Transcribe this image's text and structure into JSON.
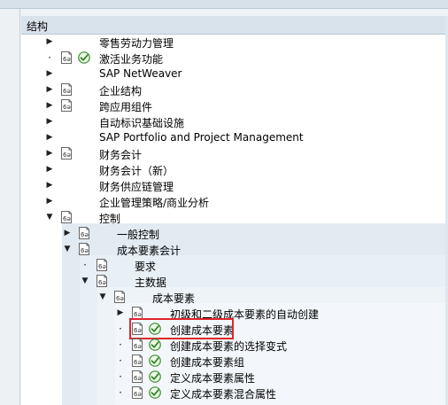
{
  "header": {
    "title": "结构"
  },
  "icons": {
    "activity": "activity-doc-icon",
    "exec": "execute-checkmark-icon"
  },
  "colors": {
    "highlight_box": "#e0262b"
  },
  "tree": [
    {
      "label": "零售劳动力管理",
      "level": 0,
      "type": "collapsed",
      "doc": false,
      "exec": false
    },
    {
      "label": "激活业务功能",
      "level": 0,
      "type": "leaf",
      "doc": true,
      "exec": true
    },
    {
      "label": "SAP NetWeaver",
      "level": 0,
      "type": "collapsed",
      "doc": false,
      "exec": false
    },
    {
      "label": "企业结构",
      "level": 0,
      "type": "collapsed",
      "doc": true,
      "exec": false
    },
    {
      "label": "跨应用组件",
      "level": 0,
      "type": "collapsed",
      "doc": true,
      "exec": false
    },
    {
      "label": "自动标识基础设施",
      "level": 0,
      "type": "collapsed",
      "doc": false,
      "exec": false
    },
    {
      "label": "SAP Portfolio and Project Management",
      "level": 0,
      "type": "collapsed",
      "doc": false,
      "exec": false
    },
    {
      "label": "财务会计",
      "level": 0,
      "type": "collapsed",
      "doc": true,
      "exec": false
    },
    {
      "label": "财务会计（新）",
      "level": 0,
      "type": "collapsed",
      "doc": false,
      "exec": false
    },
    {
      "label": "财务供应链管理",
      "level": 0,
      "type": "collapsed",
      "doc": false,
      "exec": false
    },
    {
      "label": "企业管理策略/商业分析",
      "level": 0,
      "type": "collapsed",
      "doc": false,
      "exec": false
    },
    {
      "label": "控制",
      "level": 0,
      "type": "expanded",
      "doc": true,
      "exec": false
    },
    {
      "label": "一般控制",
      "level": 1,
      "type": "collapsed",
      "doc": true,
      "exec": false
    },
    {
      "label": "成本要素会计",
      "level": 1,
      "type": "expanded",
      "doc": true,
      "exec": false
    },
    {
      "label": "要求",
      "level": 2,
      "type": "leaf",
      "doc": true,
      "exec": false
    },
    {
      "label": "主数据",
      "level": 2,
      "type": "expanded",
      "doc": true,
      "exec": false
    },
    {
      "label": "成本要素",
      "level": 3,
      "type": "expanded",
      "doc": true,
      "exec": false
    },
    {
      "label": "初级和二级成本要素的自动创建",
      "level": 4,
      "type": "collapsed",
      "doc": true,
      "exec": false
    },
    {
      "label": "创建成本要素",
      "level": 4,
      "type": "leaf",
      "doc": true,
      "exec": true,
      "highlighted": true
    },
    {
      "label": "创建成本要素的选择变式",
      "level": 4,
      "type": "leaf",
      "doc": true,
      "exec": true
    },
    {
      "label": "创建成本要素组",
      "level": 4,
      "type": "leaf",
      "doc": true,
      "exec": true
    },
    {
      "label": "定义成本要素属性",
      "level": 4,
      "type": "leaf",
      "doc": true,
      "exec": true
    },
    {
      "label": "定义成本要素混合属性",
      "level": 4,
      "type": "leaf",
      "doc": true,
      "exec": true
    }
  ]
}
